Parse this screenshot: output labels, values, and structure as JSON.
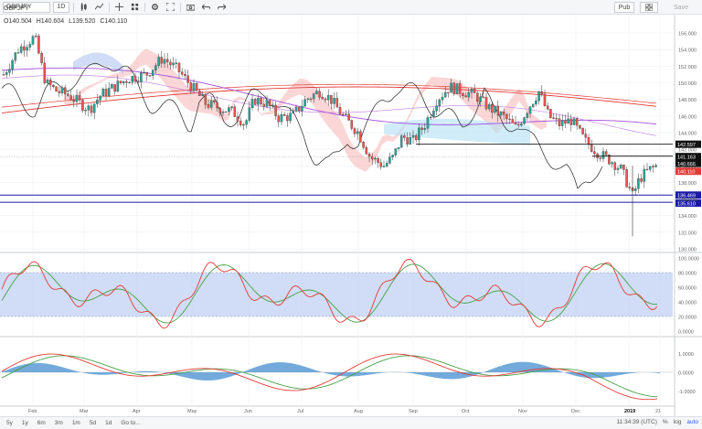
{
  "toolbar": {
    "symbol": "GBPJPY",
    "interval": "1D",
    "right_button": "Pub",
    "right_save": "Save"
  },
  "ohlc": {
    "open": "O140.504",
    "high": "H140.604",
    "low": "L139.520",
    "close": "C140.110"
  },
  "price_axis": {
    "ticks": [
      "156.000",
      "154.000",
      "152.000",
      "150.000",
      "148.000",
      "146.000",
      "144.000",
      "142.000",
      "140.000",
      "138.000",
      "136.000",
      "134.000",
      "132.000",
      "130.000"
    ],
    "labels": [
      {
        "text": "142.597",
        "bg": "#111111"
      },
      {
        "text": "141.163",
        "bg": "#111111"
      },
      {
        "text": "140.666",
        "bg": "#111111"
      },
      {
        "text": "140.110",
        "bg": "#e53935"
      },
      {
        "text": "136.469",
        "bg": "#1a1aa8"
      },
      {
        "text": "135.610",
        "bg": "#1a1aa8"
      }
    ]
  },
  "stoch_axis": {
    "ticks": [
      "100.0000",
      "80.0000",
      "60.0000",
      "40.0000",
      "20.0000",
      "0.0000"
    ]
  },
  "macd_axis": {
    "ticks": [
      "1.0000",
      "0.0000",
      "-1.0000"
    ]
  },
  "time_axis": {
    "labels": [
      "Feb",
      "Mar",
      "Apr",
      "May",
      "Jun",
      "Jul",
      "Aug",
      "Sep",
      "Oct",
      "Nov",
      "Dec",
      "2019",
      "21"
    ]
  },
  "bottombar": {
    "ranges": [
      "5y",
      "1y",
      "6m",
      "3m",
      "1m",
      "5d",
      "1d",
      "Go to..."
    ],
    "clock": "11:34:39 (UTC)",
    "percent": "%",
    "log": "log",
    "auto": "auto"
  },
  "colors": {
    "up": "#26a69a",
    "down": "#ef5350",
    "stoch_k": "#e53935",
    "stoch_d": "#43a047",
    "macd_hist": "#5b9bd5",
    "ma_red": "#e53935",
    "ma_purple": "#a64ee0",
    "cloud": "#f7b5b5",
    "cloud_blue": "#b3c7f0"
  }
}
